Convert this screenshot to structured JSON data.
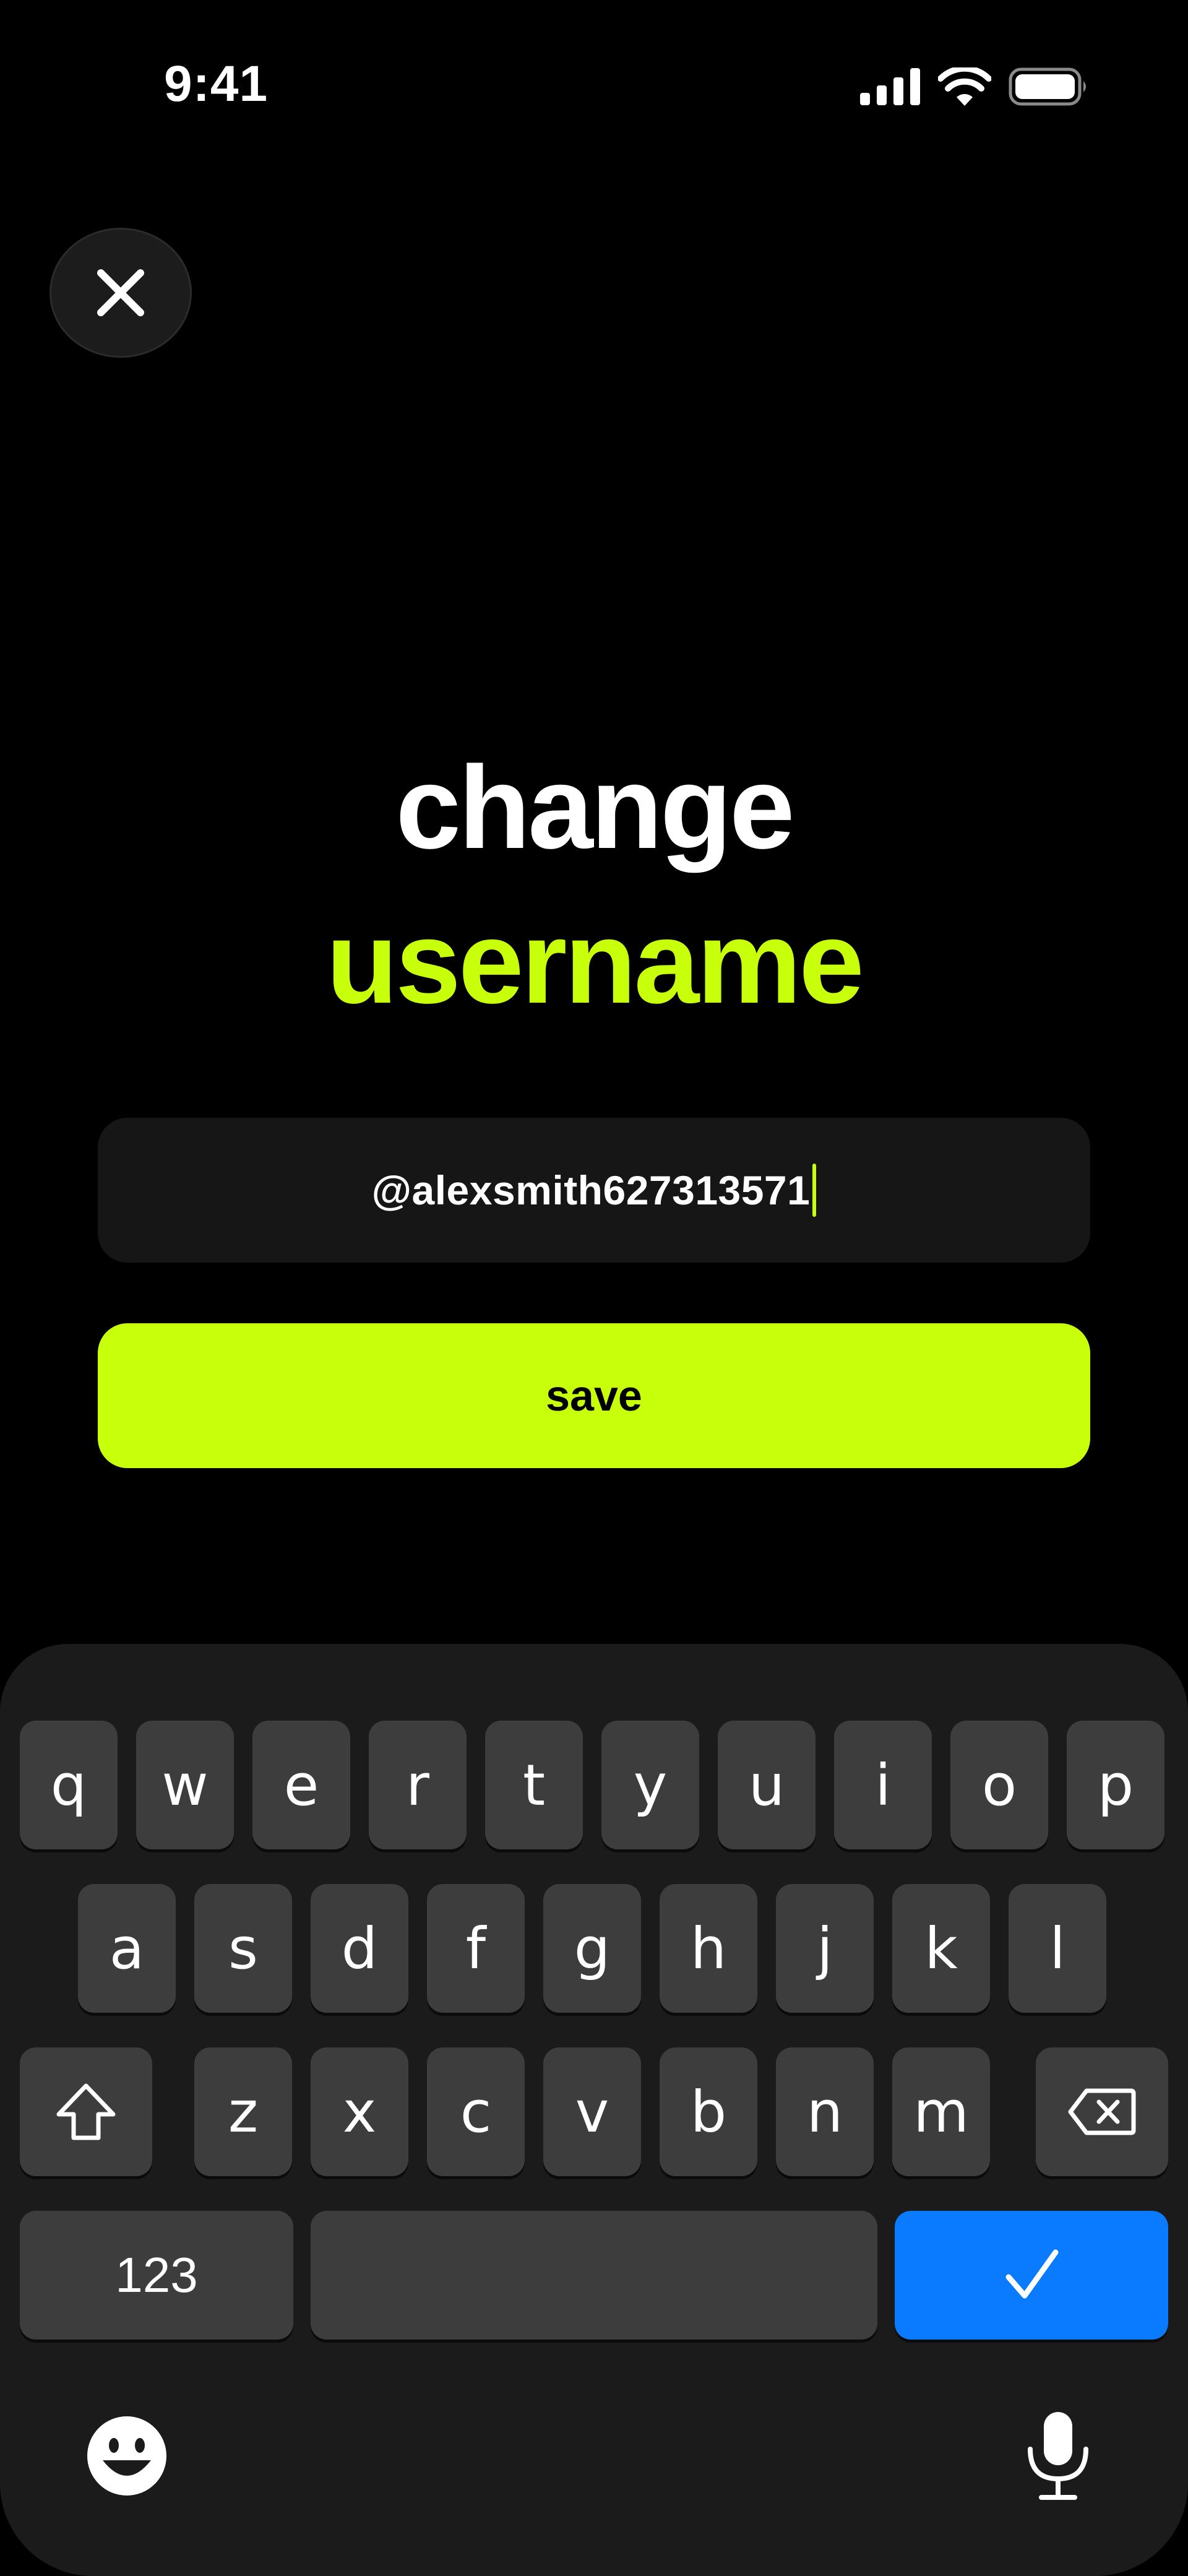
{
  "status_bar": {
    "time": "9:41"
  },
  "title": {
    "line1": "change",
    "line2": "username"
  },
  "username_field": {
    "value": "@alexsmith627313571"
  },
  "save_button": {
    "label": "save"
  },
  "colors": {
    "accent": "#c8ff0a",
    "background": "#000000",
    "field": "#161616",
    "done_key": "#0a7aff"
  },
  "keyboard": {
    "row1": [
      "q",
      "w",
      "e",
      "r",
      "t",
      "y",
      "u",
      "i",
      "o",
      "p"
    ],
    "row2": [
      "a",
      "s",
      "d",
      "f",
      "g",
      "h",
      "j",
      "k",
      "l"
    ],
    "row3": [
      "z",
      "x",
      "c",
      "v",
      "b",
      "n",
      "m"
    ],
    "numbers_key": "123",
    "icons": [
      "shift-icon",
      "delete-icon",
      "checkmark-icon",
      "emoji-icon",
      "microphone-icon"
    ]
  }
}
